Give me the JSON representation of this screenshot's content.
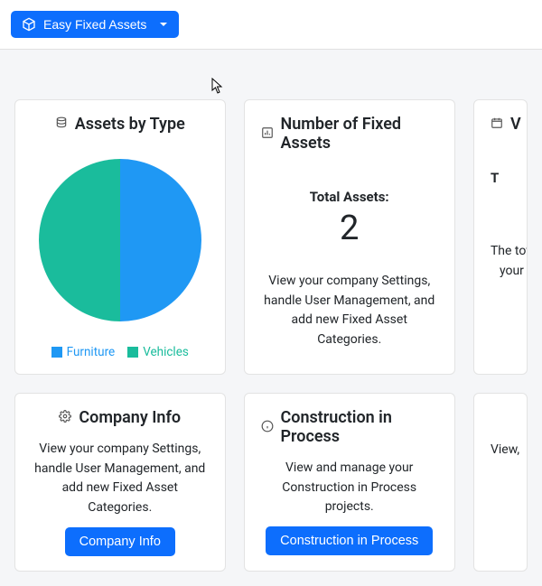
{
  "topbar": {
    "brand_label": "Easy Fixed Assets"
  },
  "cards": {
    "assets_by_type": {
      "title": "Assets by Type",
      "legend": {
        "furniture": "Furniture",
        "vehicles": "Vehicles"
      }
    },
    "number_fixed": {
      "title": "Number of Fixed Assets",
      "total_label": "Total Assets:",
      "total_value": "2",
      "desc": "View your company Settings, handle User Management, and add new Fixed Asset Categories."
    },
    "value_cut": {
      "title_leading_char": "V",
      "total_label_fragment": "T",
      "desc_line1": "The tota",
      "desc_line2": "your"
    },
    "company_info": {
      "title": "Company Info",
      "desc": "View your company Settings, handle User Management, and add new Fixed Asset Categories.",
      "button": "Company Info"
    },
    "cip": {
      "title": "Construction in Process",
      "desc": "View and manage your Construction in Process projects.",
      "button": "Construction in Process"
    },
    "vendors_cut": {
      "desc_fragment": "View,"
    }
  },
  "chart_data": {
    "type": "pie",
    "title": "Assets by Type",
    "categories": [
      "Furniture",
      "Vehicles"
    ],
    "values": [
      1,
      1
    ],
    "series_colors": [
      "#1f98f4",
      "#1abc9c"
    ]
  }
}
